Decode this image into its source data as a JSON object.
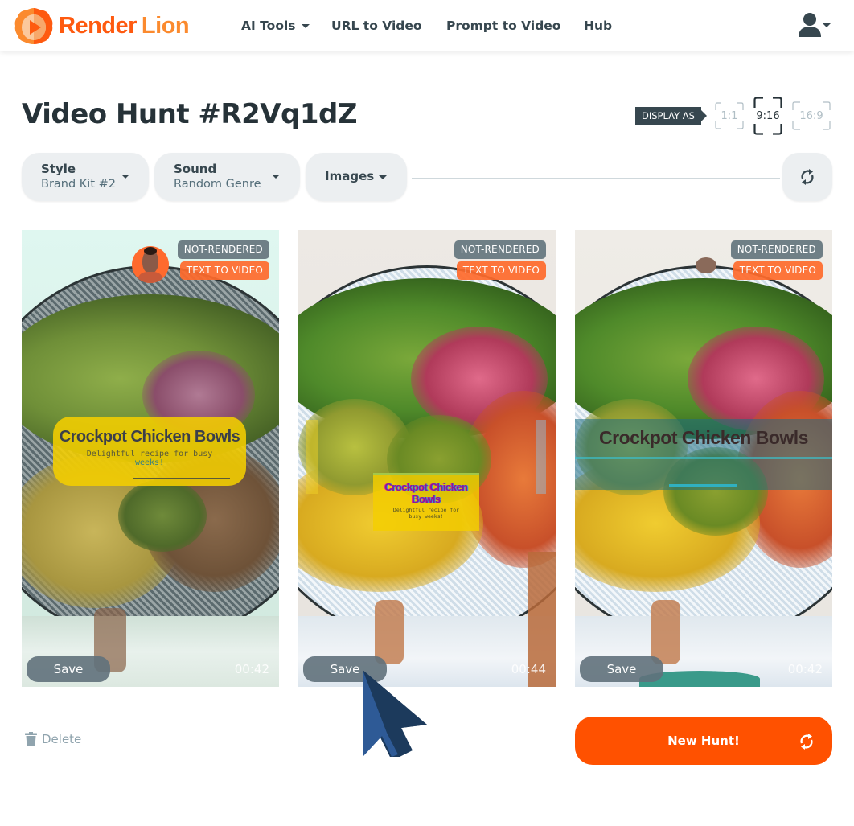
{
  "brand": {
    "name_part1": "Render",
    "name_part2": "Lion",
    "accent": "#ff5100",
    "logo_icon": "lion-play-icon"
  },
  "nav": {
    "items": [
      {
        "label": "AI Tools",
        "has_dropdown": true
      },
      {
        "label": "URL to Video",
        "has_dropdown": false
      },
      {
        "label": "Prompt to Video",
        "has_dropdown": false
      },
      {
        "label": "Hub",
        "has_dropdown": false
      }
    ],
    "user_icon": "user-icon"
  },
  "page": {
    "title": "Video Hunt #R2Vq1dZ",
    "display_as_label": "DISPLAY AS",
    "ratios": [
      {
        "label": "1:1",
        "active": false
      },
      {
        "label": "9:16",
        "active": true
      },
      {
        "label": "16:9",
        "active": false
      }
    ]
  },
  "options": {
    "style": {
      "label": "Style",
      "value": "Brand Kit #2"
    },
    "sound": {
      "label": "Sound",
      "value": "Random Genre"
    },
    "images": {
      "label": "Images"
    },
    "regenerate_icon": "refresh-icon"
  },
  "cards": [
    {
      "status": "NOT-RENDERED",
      "type": "TEXT TO VIDEO",
      "overlay_title": "Crockpot Chicken Bowls",
      "overlay_subtitle_1": "Delightful recipe for busy",
      "overlay_subtitle_2": "weeks!",
      "save_label": "Save",
      "duration": "00:42"
    },
    {
      "status": "NOT-RENDERED",
      "type": "TEXT TO VIDEO",
      "overlay_title_1": "Crockpot Chicken",
      "overlay_title_2": "Bowls",
      "overlay_subtitle_1": "Delightful recipe for",
      "overlay_subtitle_2": "busy weeks!",
      "save_label": "Save",
      "duration": "00:44"
    },
    {
      "status": "NOT-RENDERED",
      "type": "TEXT TO VIDEO",
      "overlay_title": "Crockpot Chicken Bowls",
      "save_label": "Save",
      "duration": "00:42"
    }
  ],
  "footer": {
    "delete_label": "Delete",
    "new_hunt_label": "New Hunt!"
  }
}
